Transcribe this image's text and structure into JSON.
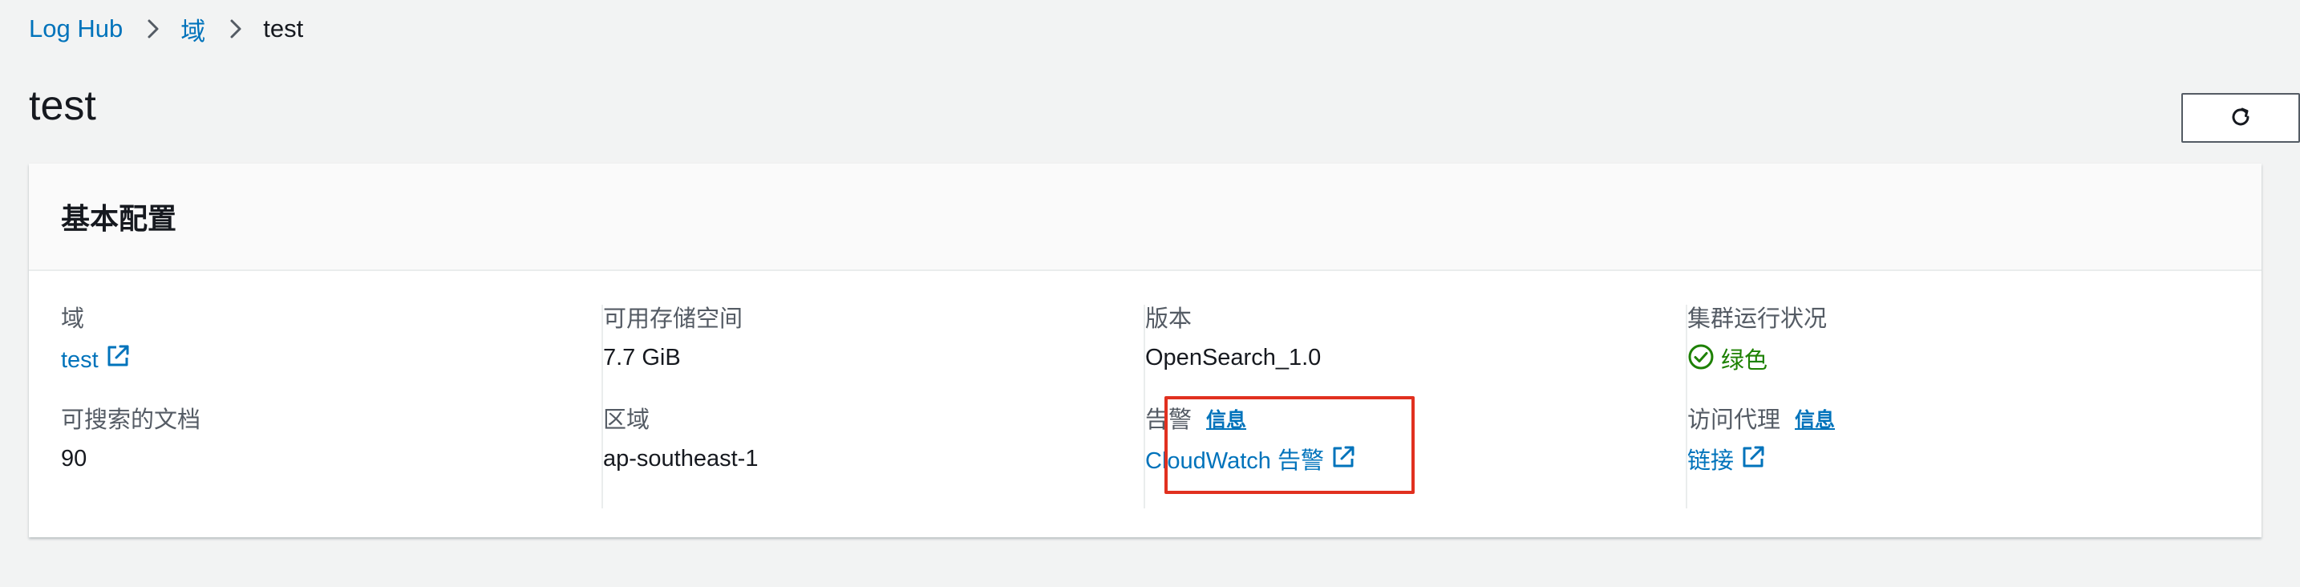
{
  "breadcrumb": {
    "root": "Log Hub",
    "section": "域",
    "current": "test"
  },
  "page": {
    "title": "test"
  },
  "card": {
    "header": "基本配置",
    "domain": {
      "label": "域",
      "value": "test"
    },
    "documents": {
      "label": "可搜索的文档",
      "value": "90"
    },
    "storage": {
      "label": "可用存储空间",
      "value": "7.7 GiB"
    },
    "region": {
      "label": "区域",
      "value": "ap-southeast-1"
    },
    "version": {
      "label": "版本",
      "value": "OpenSearch_1.0"
    },
    "alarms": {
      "label": "告警",
      "info": "信息",
      "value": "CloudWatch 告警"
    },
    "health": {
      "label": "集群运行状况",
      "value": "绿色"
    },
    "proxy": {
      "label": "访问代理",
      "info": "信息",
      "value": "链接"
    }
  },
  "colors": {
    "link": "#0073bb",
    "success": "#1d8102",
    "highlight": "#e1301f",
    "text": "#16191f"
  },
  "icons": [
    "chevron-right-icon",
    "refresh-icon",
    "external-link-icon",
    "check-circle-icon"
  ]
}
